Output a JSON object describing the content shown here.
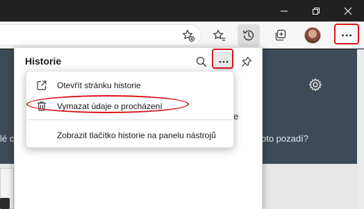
{
  "panel": {
    "title": "Historie"
  },
  "menu": {
    "items": [
      {
        "label": "Otevřít stránku historie",
        "icon": "open-external-icon"
      },
      {
        "label": "Vymazat údaje o procházení",
        "icon": "trash-icon"
      },
      {
        "label": "Zobrazit tlačítko historie na panelu nástrojů",
        "icon": ""
      }
    ]
  },
  "background_page": {
    "left_text": "lé c",
    "right_text": "oto pozadí?",
    "fragment": "e"
  },
  "colors": {
    "annotation": "#d9131d",
    "titlebar": "#202020",
    "toolbar": "#f7f7f7"
  }
}
